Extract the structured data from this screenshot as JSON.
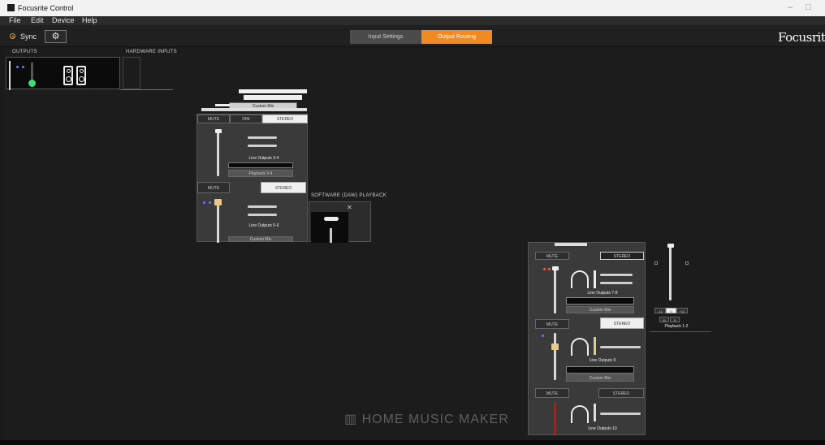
{
  "window": {
    "title": "Focusrite Control",
    "minimize": "–",
    "maximize": "□"
  },
  "menu": [
    "File",
    "Edit",
    "Device",
    "Help"
  ],
  "toolbar": {
    "sync_label": "Sync",
    "settings_icon": "gear-icon"
  },
  "tabs": [
    {
      "label": "Input Settings",
      "active": false
    },
    {
      "label": "Output Routing",
      "active": true
    }
  ],
  "brand": "Focusrit",
  "colors": {
    "accent": "#f28a24",
    "sync": "#f2a23a",
    "meter_green": "#3adf73"
  },
  "sections": {
    "outputs": "OUTPUTS",
    "hardware_inputs": "HARDWARE INPUTS",
    "software_playback": "SOFTWARE (DAW) PLAYBACK"
  },
  "popup_left": {
    "top_strip": {
      "label": "Custom Mix"
    },
    "row1": {
      "buttons": [
        "MUTE",
        "DIM",
        "STEREO"
      ],
      "name": "Line Outputs 3-4",
      "source": "Playback 3-4"
    },
    "row2": {
      "buttons": [
        "MUTE",
        "STEREO"
      ],
      "name": "Line Outputs 5-6",
      "source": "Custom Mix"
    }
  },
  "popup_right": {
    "row1": {
      "buttons": [
        "MUTE",
        "STEREO"
      ],
      "name": "Line Outputs 7-8",
      "source": "Custom Mix"
    },
    "row2": {
      "buttons": [
        "MUTE",
        "STEREO"
      ],
      "name": "Line Outputs 9",
      "source": "Custom Mix"
    },
    "row3": {
      "buttons": [
        "MUTE",
        "STEREO"
      ],
      "name": "Line Outputs 10"
    }
  },
  "playback": {
    "name": "Playback 1-2",
    "buttons": [
      "-12",
      "0",
      "+12"
    ],
    "pan_buttons": [
      "M",
      "S"
    ]
  },
  "watermark": "HOME MUSIC MAKER"
}
